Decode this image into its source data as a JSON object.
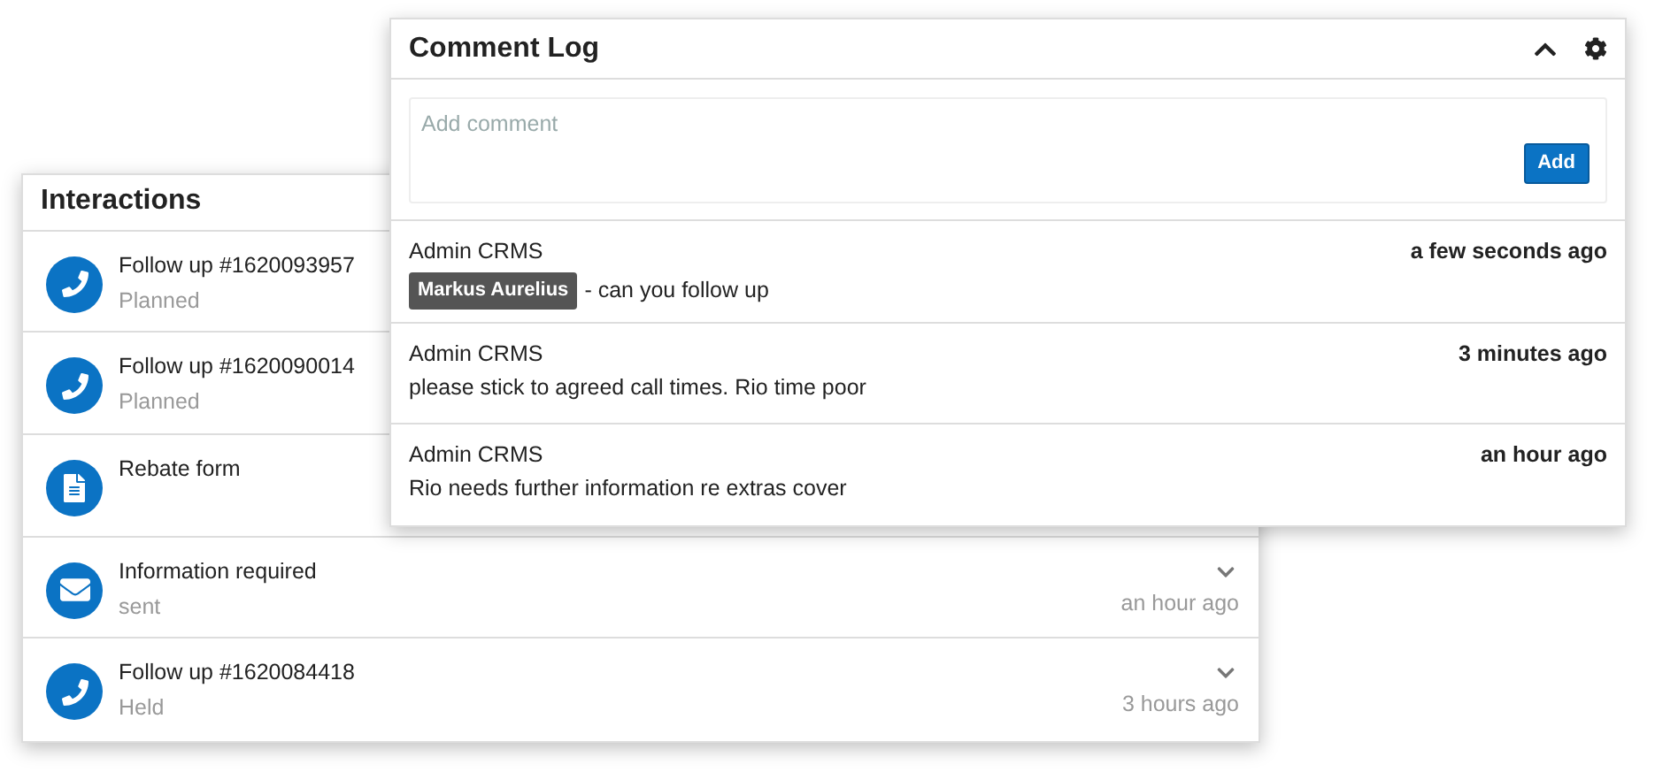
{
  "interactions": {
    "title": "Interactions",
    "items": [
      {
        "kind": "call",
        "title": "Follow up #1620093957",
        "status": "Planned"
      },
      {
        "kind": "call",
        "title": "Follow up #1620090014",
        "status": "Planned"
      },
      {
        "kind": "document",
        "title": "Rebate form"
      },
      {
        "kind": "email",
        "title": "Information required",
        "status": "sent",
        "time": "an hour ago"
      },
      {
        "kind": "call",
        "title": "Follow up #1620084418",
        "status": "Held",
        "time": "3 hours ago"
      }
    ]
  },
  "comment_log": {
    "title": "Comment Log",
    "comment_field": {
      "placeholder": "Add comment"
    },
    "add_button": "Add",
    "comments": [
      {
        "author": "Admin CRMS",
        "time": "a few seconds ago",
        "mention": "Markus Aurelius",
        "text": "- can you follow up"
      },
      {
        "author": "Admin CRMS",
        "time": "3 minutes ago",
        "text": "please stick to agreed call times. Rio time poor"
      },
      {
        "author": "Admin CRMS",
        "time": "an hour ago",
        "text": "Rio needs further information re extras cover"
      }
    ]
  }
}
